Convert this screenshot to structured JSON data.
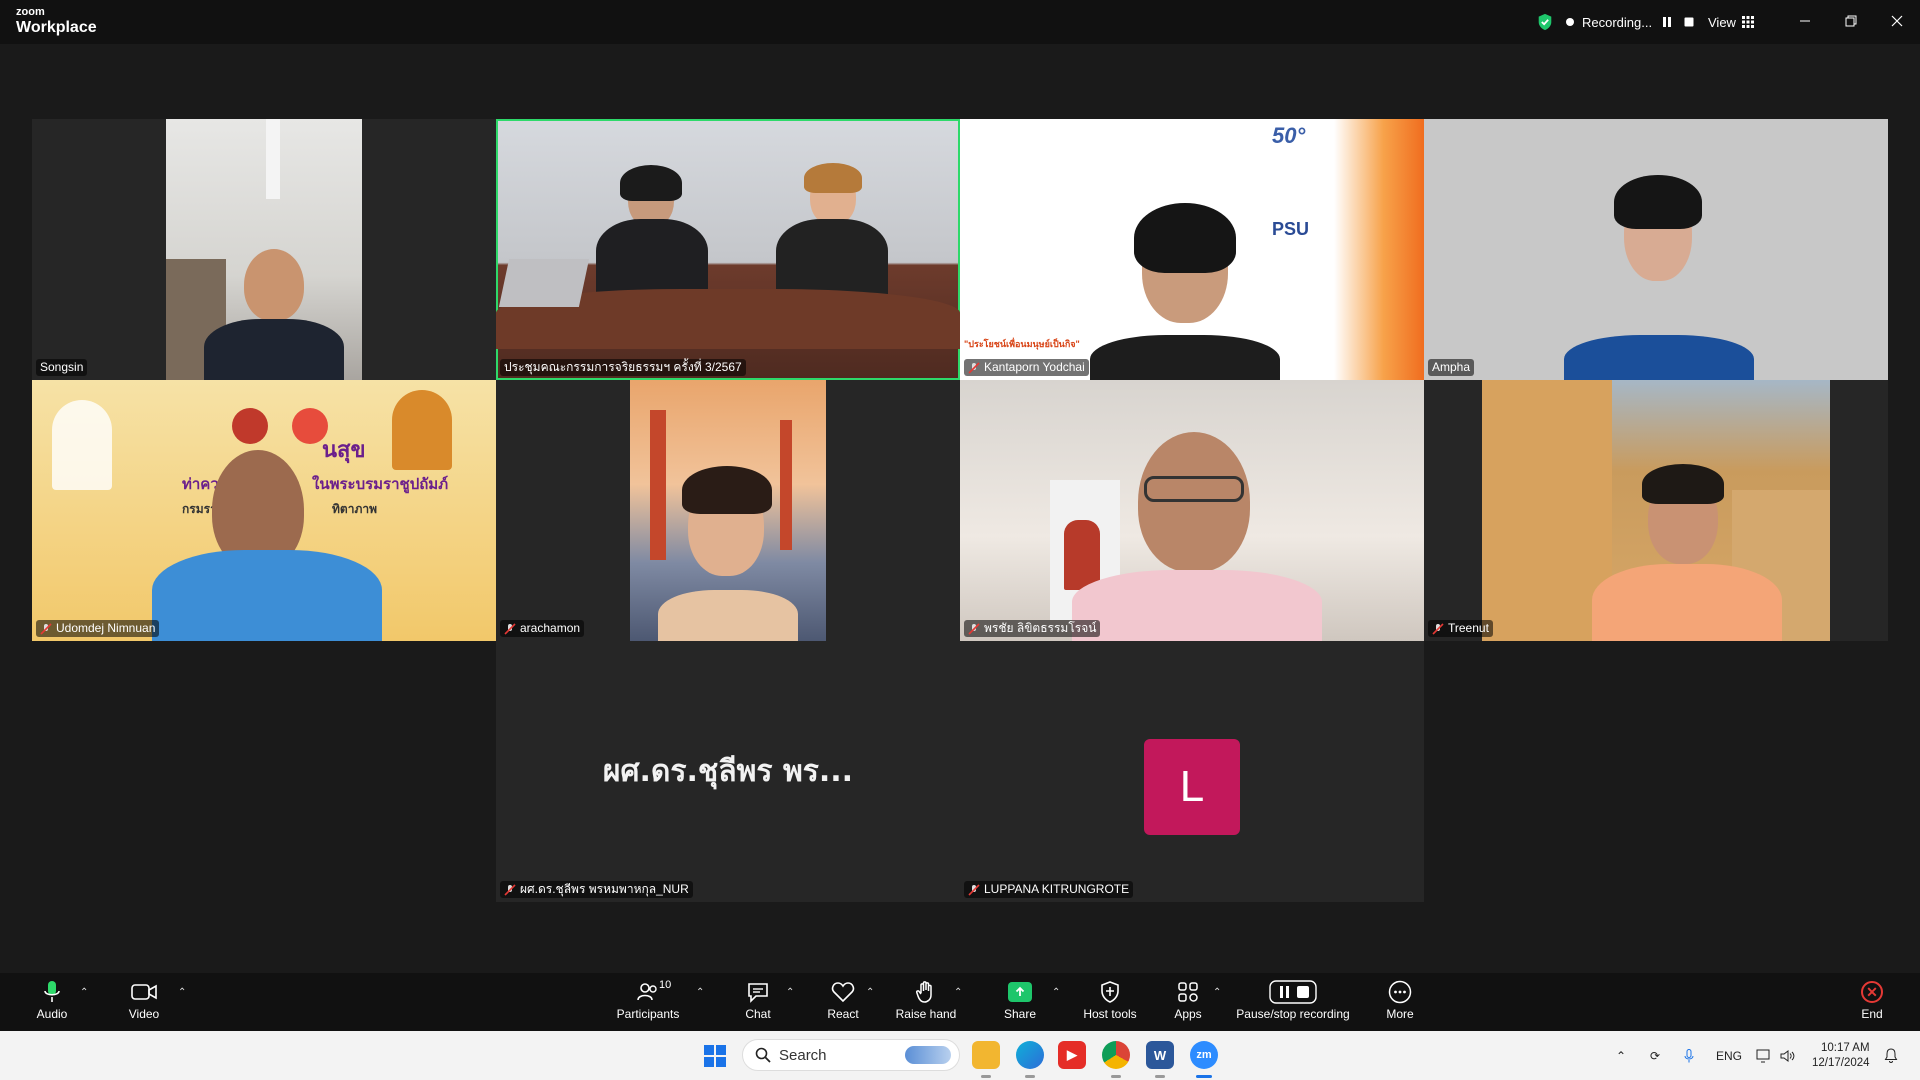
{
  "app": {
    "brand_top": "zoom",
    "brand_bottom": "Workplace"
  },
  "header": {
    "recording_label": "Recording...",
    "view_label": "View"
  },
  "participants": [
    {
      "name": "Songsin",
      "muted": false
    },
    {
      "name": "ประชุมคณะกรรมการจริยธรรมฯ ครั้งที่ 3/2567",
      "muted": false,
      "active_speaker": true
    },
    {
      "name": "Kantaporn Yodchai",
      "muted": true
    },
    {
      "name": "Ampha",
      "muted": false
    },
    {
      "name": "Udomdej Nimnuan",
      "muted": true
    },
    {
      "name": "arachamon",
      "muted": true
    },
    {
      "name": "พรชัย ลิขิตธรรมโรจน์",
      "muted": true
    },
    {
      "name": "Treenut",
      "muted": true
    },
    {
      "name": "ผศ.ดร.ชุลีพร พรหมพาหกุล_NUR",
      "muted": true,
      "display_text": "ผศ.ดร.ชุลีพร พร..."
    },
    {
      "name": "LUPPANA KITRUNGROTE",
      "muted": true,
      "avatar_letter": "L"
    }
  ],
  "backgrounds": {
    "psu_tagline": "\"ประโยชน์เพื่อนมนุษย์เป็นกิจ\"",
    "psu_logo": "PSU",
    "anniversary": "50",
    "banner_line1": "ท่าความ ดี เพื่อชา",
    "banner_line2": "ในพระบรมราชูปถัมภ์",
    "banner_heading": "นสุข",
    "banner_sub": "กรมราชทั",
    "banner_sub2": "ทิตาภาพ"
  },
  "toolbar": {
    "audio": "Audio",
    "video": "Video",
    "participants": "Participants",
    "participants_count": "10",
    "chat": "Chat",
    "react": "React",
    "raise_hand": "Raise hand",
    "share": "Share",
    "host_tools": "Host tools",
    "apps": "Apps",
    "pause_stop": "Pause/stop recording",
    "more": "More",
    "end": "End"
  },
  "taskbar": {
    "search_placeholder": "Search",
    "lang": "ENG",
    "time": "10:17 AM",
    "date": "12/17/2024"
  },
  "colors": {
    "accent_green": "#2ed96a",
    "share_green": "#1ec66b",
    "end_red": "#e53935",
    "avatar_bg": "#c2185b"
  }
}
